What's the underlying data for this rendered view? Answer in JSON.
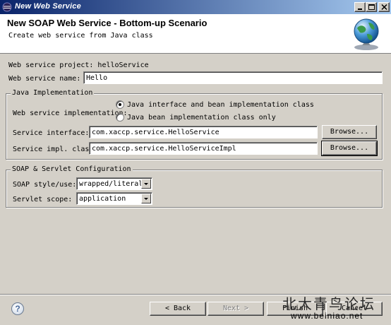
{
  "window": {
    "title": "New Web Service",
    "minimize_icon": "minimize-icon",
    "maximize_icon": "maximize-icon",
    "close_icon": "close-icon"
  },
  "header": {
    "title": "New SOAP Web Service - Bottom-up Scenario",
    "description": "Create web service from Java class",
    "icon": "globe-icon"
  },
  "form": {
    "project_label": "Web service project: helloService",
    "name_label": "Web service name:",
    "name_value": "Hello"
  },
  "java_impl": {
    "group_title": "Java Implementation",
    "impl_label": "Web service implementation:",
    "option_interface": "Java interface and bean implementation class",
    "option_bean_only": "Java bean implementation class only",
    "selected": "Java interface and bean implementation class",
    "interface_label": "Service interface:",
    "interface_value": "com.xaccp.service.HelloService",
    "impl_class_label": "Service impl. class:",
    "impl_class_value": "com.xaccp.service.HelloServiceImpl",
    "browse_label": "Browse..."
  },
  "soap": {
    "group_title": "SOAP & Servlet Configuration",
    "style_label": "SOAP style/use:",
    "style_value": "wrapped/literal",
    "scope_label": "Servlet scope:",
    "scope_value": "application"
  },
  "buttons": {
    "back": "< Back",
    "next": "Next >",
    "finish": "Finish",
    "cancel": "Cancel"
  },
  "watermark": {
    "text": "北大青鸟论坛",
    "url": "www.beiniao.net"
  }
}
